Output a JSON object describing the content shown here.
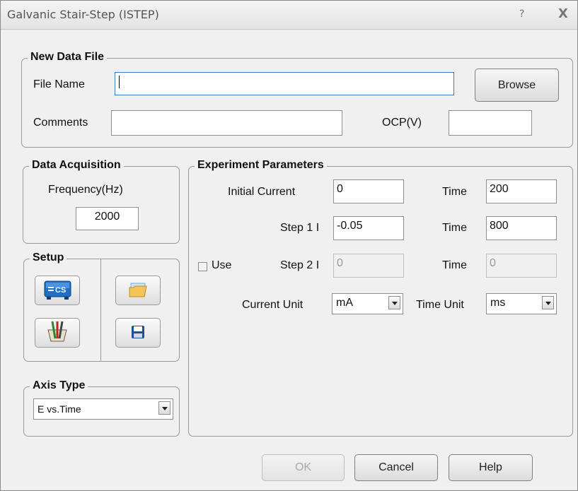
{
  "window": {
    "title": "Galvanic Stair-Step (ISTEP)",
    "help_glyph": "?",
    "close_glyph": "X"
  },
  "new_data_file": {
    "legend": "New Data File",
    "file_name_label": "File Name",
    "file_name_value": "",
    "browse_label": "Browse",
    "comments_label": "Comments",
    "comments_value": "",
    "ocp_label": "OCP(V)",
    "ocp_value": ""
  },
  "data_acquisition": {
    "legend": "Data Acquisition",
    "frequency_label": "Frequency(Hz)",
    "frequency_value": "2000"
  },
  "setup": {
    "legend": "Setup",
    "icons": [
      "cs-instrument-icon",
      "open-folder-icon",
      "electrode-cell-icon",
      "save-disk-icon"
    ],
    "cs_icon_text": "CS"
  },
  "axis_type": {
    "legend": "Axis Type",
    "selected": "E vs.Time"
  },
  "experiment_parameters": {
    "legend": "Experiment Parameters",
    "initial_current_label": "Initial Current",
    "initial_current_value": "0",
    "time1_label": "Time",
    "time1_value": "200",
    "step1_label": "Step 1 I",
    "step1_value": "-0.05",
    "time2_label": "Time",
    "time2_value": "800",
    "use_label": "Use",
    "use_checked": false,
    "step2_label": "Step 2 I",
    "step2_value": "0",
    "time3_label": "Time",
    "time3_value": "0",
    "current_unit_label": "Current Unit",
    "current_unit_value": "mA",
    "time_unit_label": "Time Unit",
    "time_unit_value": "ms"
  },
  "footer": {
    "ok_label": "OK",
    "cancel_label": "Cancel",
    "help_label": "Help"
  },
  "colors": {
    "accent_blue": "#1f6fc5",
    "focus_border": "#3b7fd0"
  }
}
